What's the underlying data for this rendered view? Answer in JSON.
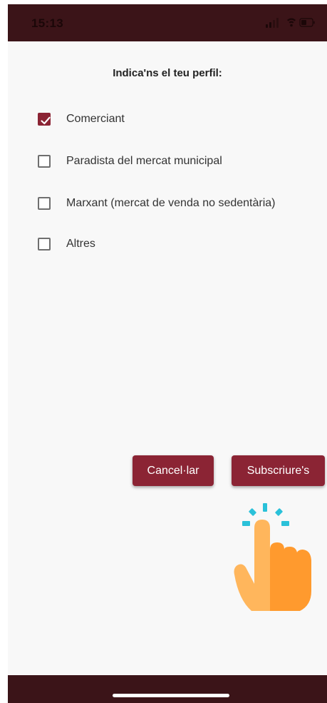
{
  "status_bar": {
    "time": "15:13"
  },
  "title": "Indica'ns el teu perfil:",
  "options": [
    {
      "label": "Comerciant",
      "checked": true
    },
    {
      "label": "Paradista del mercat municipal",
      "checked": false
    },
    {
      "label": "Marxant (mercat de venda no sedentària)",
      "checked": false
    },
    {
      "label": "Altres",
      "checked": false
    }
  ],
  "buttons": {
    "cancel": "Cancel·lar",
    "subscribe": "Subscriure's"
  },
  "colors": {
    "accent": "#8b2434",
    "bar": "#3b1418",
    "background": "#f8f8f8"
  },
  "icons": {
    "tap_hint": "tap-hand-icon"
  }
}
